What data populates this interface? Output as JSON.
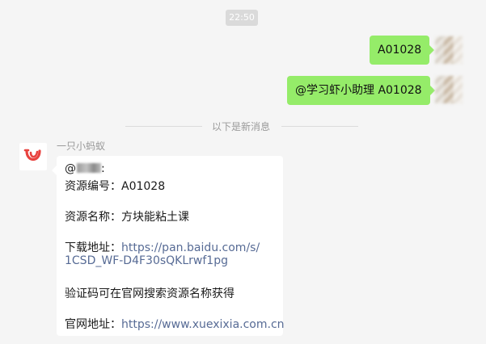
{
  "time": "22:50",
  "outgoing": [
    {
      "text": "A01028"
    },
    {
      "text": "@学习虾小助理 A01028"
    }
  ],
  "divider": "以下是新消息",
  "incoming": {
    "sender": "一只小蚂蚁",
    "mention_prefix": "@",
    "mention_suffix": ":",
    "lines": {
      "resource_id_label": "资源编号：",
      "resource_id_value": "A01028",
      "resource_name_label": "资源名称：",
      "resource_name_value": "方块能粘土课",
      "download_label": "下载地址：",
      "download_url_part1": "https://pan.baidu.com/s/",
      "download_url_part2": "1CSD_WF-D4F30sQKLrwf1pg",
      "verify_note": "验证码可在官网搜索资源名称获得",
      "site_label": "官网地址：",
      "site_url": "https://www.xuexixia.com.cn"
    }
  },
  "colors": {
    "outgoing_bubble": "#95ec69",
    "link": "#576b95",
    "bot_logo": "#e8423f"
  }
}
